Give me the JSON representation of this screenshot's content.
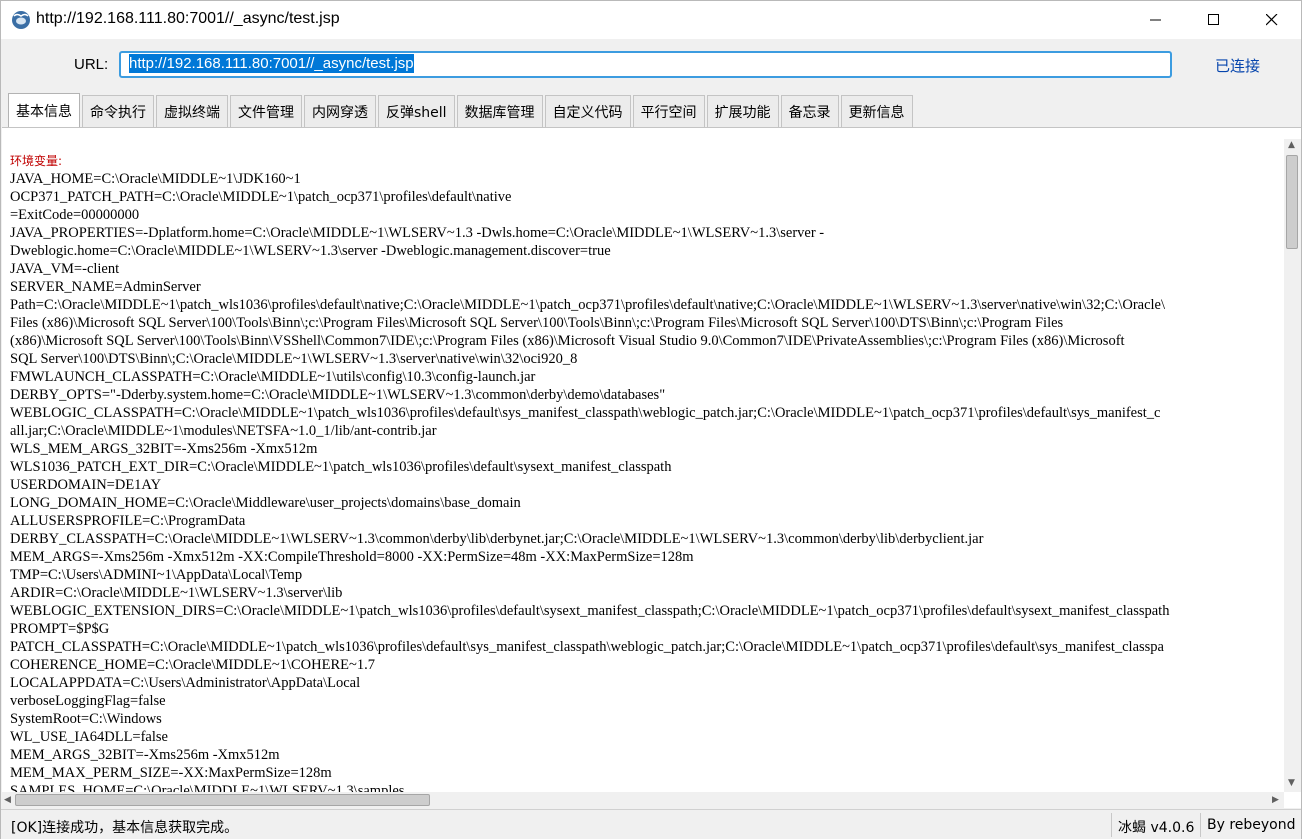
{
  "window": {
    "title": "http://192.168.111.80:7001//_async/test.jsp"
  },
  "url_bar": {
    "label": "URL:",
    "value": "http://192.168.111.80:7001//_async/test.jsp",
    "status": "已连接"
  },
  "tabs": [
    {
      "label": "基本信息",
      "active": true
    },
    {
      "label": "命令执行"
    },
    {
      "label": "虚拟终端"
    },
    {
      "label": "文件管理"
    },
    {
      "label": "内网穿透"
    },
    {
      "label": "反弹shell"
    },
    {
      "label": "数据库管理"
    },
    {
      "label": "自定义代码"
    },
    {
      "label": "平行空间"
    },
    {
      "label": "扩展功能"
    },
    {
      "label": "备忘录"
    },
    {
      "label": "更新信息"
    }
  ],
  "content": {
    "heading": "环境变量:",
    "lines": [
      "JAVA_HOME=C:\\Oracle\\MIDDLE~1\\JDK160~1",
      "OCP371_PATCH_PATH=C:\\Oracle\\MIDDLE~1\\patch_ocp371\\profiles\\default\\native",
      "=ExitCode=00000000",
      "JAVA_PROPERTIES=-Dplatform.home=C:\\Oracle\\MIDDLE~1\\WLSERV~1.3 -Dwls.home=C:\\Oracle\\MIDDLE~1\\WLSERV~1.3\\server -",
      "Dweblogic.home=C:\\Oracle\\MIDDLE~1\\WLSERV~1.3\\server -Dweblogic.management.discover=true",
      "JAVA_VM=-client",
      "SERVER_NAME=AdminServer",
      "Path=C:\\Oracle\\MIDDLE~1\\patch_wls1036\\profiles\\default\\native;C:\\Oracle\\MIDDLE~1\\patch_ocp371\\profiles\\default\\native;C:\\Oracle\\MIDDLE~1\\WLSERV~1.3\\server\\native\\win\\32;C:\\Oracle\\",
      "Files (x86)\\Microsoft SQL Server\\100\\Tools\\Binn\\;c:\\Program Files\\Microsoft SQL Server\\100\\Tools\\Binn\\;c:\\Program Files\\Microsoft SQL Server\\100\\DTS\\Binn\\;c:\\Program Files",
      "(x86)\\Microsoft SQL Server\\100\\Tools\\Binn\\VSShell\\Common7\\IDE\\;c:\\Program Files (x86)\\Microsoft Visual Studio 9.0\\Common7\\IDE\\PrivateAssemblies\\;c:\\Program Files (x86)\\Microsoft",
      "SQL Server\\100\\DTS\\Binn\\;C:\\Oracle\\MIDDLE~1\\WLSERV~1.3\\server\\native\\win\\32\\oci920_8",
      "FMWLAUNCH_CLASSPATH=C:\\Oracle\\MIDDLE~1\\utils\\config\\10.3\\config-launch.jar",
      "DERBY_OPTS=\"-Dderby.system.home=C:\\Oracle\\MIDDLE~1\\WLSERV~1.3\\common\\derby\\demo\\databases\"",
      "WEBLOGIC_CLASSPATH=C:\\Oracle\\MIDDLE~1\\patch_wls1036\\profiles\\default\\sys_manifest_classpath\\weblogic_patch.jar;C:\\Oracle\\MIDDLE~1\\patch_ocp371\\profiles\\default\\sys_manifest_c",
      "all.jar;C:\\Oracle\\MIDDLE~1\\modules\\NETSFA~1.0_1/lib/ant-contrib.jar",
      "WLS_MEM_ARGS_32BIT=-Xms256m -Xmx512m",
      "WLS1036_PATCH_EXT_DIR=C:\\Oracle\\MIDDLE~1\\patch_wls1036\\profiles\\default\\sysext_manifest_classpath",
      "USERDOMAIN=DE1AY",
      "LONG_DOMAIN_HOME=C:\\Oracle\\Middleware\\user_projects\\domains\\base_domain",
      "ALLUSERSPROFILE=C:\\ProgramData",
      "DERBY_CLASSPATH=C:\\Oracle\\MIDDLE~1\\WLSERV~1.3\\common\\derby\\lib\\derbynet.jar;C:\\Oracle\\MIDDLE~1\\WLSERV~1.3\\common\\derby\\lib\\derbyclient.jar",
      "MEM_ARGS=-Xms256m -Xmx512m -XX:CompileThreshold=8000 -XX:PermSize=48m -XX:MaxPermSize=128m",
      "TMP=C:\\Users\\ADMINI~1\\AppData\\Local\\Temp",
      "ARDIR=C:\\Oracle\\MIDDLE~1\\WLSERV~1.3\\server\\lib",
      "WEBLOGIC_EXTENSION_DIRS=C:\\Oracle\\MIDDLE~1\\patch_wls1036\\profiles\\default\\sysext_manifest_classpath;C:\\Oracle\\MIDDLE~1\\patch_ocp371\\profiles\\default\\sysext_manifest_classpath",
      "PROMPT=$P$G",
      "PATCH_CLASSPATH=C:\\Oracle\\MIDDLE~1\\patch_wls1036\\profiles\\default\\sys_manifest_classpath\\weblogic_patch.jar;C:\\Oracle\\MIDDLE~1\\patch_ocp371\\profiles\\default\\sys_manifest_classpa",
      "COHERENCE_HOME=C:\\Oracle\\MIDDLE~1\\COHERE~1.7",
      "LOCALAPPDATA=C:\\Users\\Administrator\\AppData\\Local",
      "verboseLoggingFlag=false",
      "SystemRoot=C:\\Windows",
      "WL_USE_IA64DLL=false",
      "MEM_ARGS_32BIT=-Xms256m -Xmx512m",
      "MEM_MAX_PERM_SIZE=-XX:MaxPermSize=128m",
      "SAMPLES_HOME=C:\\Oracle\\MIDDLE~1\\WLSERV~1.3\\samples"
    ]
  },
  "status_bar": {
    "message": "[OK]连接成功，基本信息获取完成。",
    "version": "冰蝎 v4.0.6",
    "author": "By rebeyond"
  }
}
